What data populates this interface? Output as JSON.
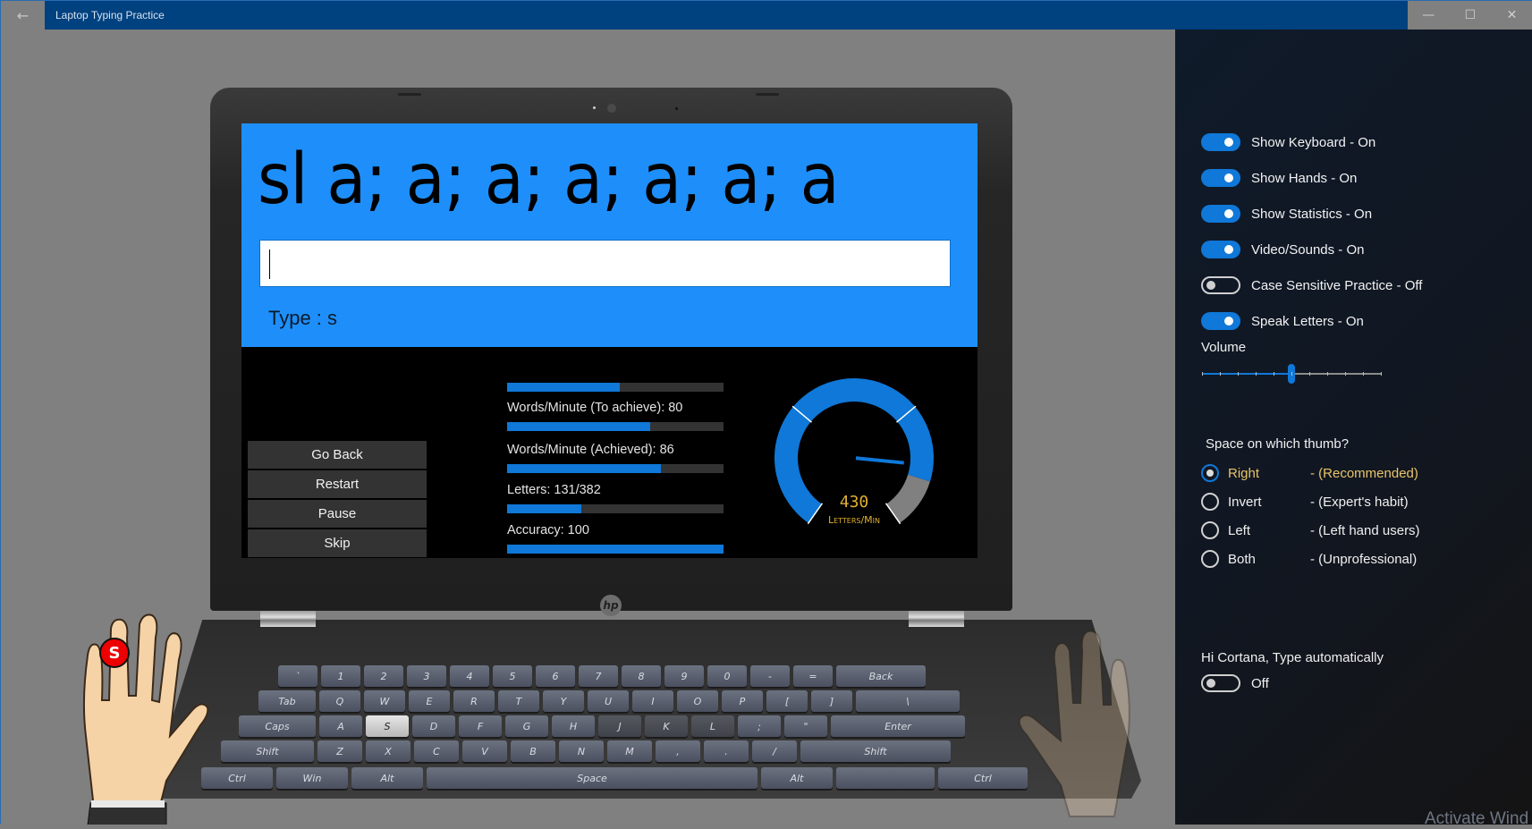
{
  "window": {
    "title": "Laptop Typing Practice",
    "back_icon": "←",
    "minimize_icon": "—",
    "maximize_icon": "☐",
    "close_icon": "✕"
  },
  "practice": {
    "text": "sl a; a; a; a; a; a; a",
    "input_value": "",
    "hint": "Type : s",
    "next_key": "s",
    "finger_badge": "S"
  },
  "controls": {
    "go_back": "Go Back",
    "restart": "Restart",
    "pause": "Pause",
    "skip": "Skip"
  },
  "stats": [
    {
      "label": "",
      "progress": 0.52
    },
    {
      "label": "Words/Minute (To achieve): 80",
      "progress": 0.66
    },
    {
      "label": "Words/Minute (Achieved): 86",
      "progress": 0.71
    },
    {
      "label": "Letters: 131/382",
      "progress": 0.343
    },
    {
      "label": "Accuracy: 100",
      "progress": 1.0
    }
  ],
  "gauge": {
    "value": "430",
    "unit": "Letters/Min",
    "needle_fraction": 0.83,
    "arc_color": "#0f78d8",
    "over_color": "#808080",
    "text_color": "#e0b030"
  },
  "brand": "hp",
  "keyboard": {
    "rows": [
      [
        "`",
        "1",
        "2",
        "3",
        "4",
        "5",
        "6",
        "7",
        "8",
        "9",
        "0",
        "-",
        "=",
        "Back"
      ],
      [
        "Tab",
        "Q",
        "W",
        "E",
        "R",
        "T",
        "Y",
        "U",
        "I",
        "O",
        "P",
        "[",
        "]",
        "\\"
      ],
      [
        "Caps",
        "A",
        "S",
        "D",
        "F",
        "G",
        "H",
        "J",
        "K",
        "L",
        ";",
        "\"",
        "Enter"
      ],
      [
        "Shift",
        "Z",
        "X",
        "C",
        "V",
        "B",
        "N",
        "M",
        ",",
        ".",
        "/",
        "Shift"
      ],
      [
        "Ctrl",
        "Win",
        "Alt",
        "Space",
        "Alt",
        "",
        "Ctrl"
      ]
    ],
    "active_key": "S",
    "home_keys": [
      "J",
      "K",
      "L"
    ]
  },
  "settings": {
    "toggles": [
      {
        "label": "Show Keyboard - On",
        "on": true
      },
      {
        "label": "Show Hands - On",
        "on": true
      },
      {
        "label": "Show Statistics - On",
        "on": true
      },
      {
        "label": "Video/Sounds - On",
        "on": true
      },
      {
        "label": "Case Sensitive Practice - Off",
        "on": false
      },
      {
        "label": "Speak Letters - On",
        "on": true
      }
    ],
    "volume_label": "Volume",
    "volume": 0.5,
    "thumb_question": "Space on which thumb?",
    "thumb_options": [
      {
        "name": "Right",
        "note": "- (Recommended)",
        "selected": true
      },
      {
        "name": "Invert",
        "note": "- (Expert's habit)",
        "selected": false
      },
      {
        "name": "Left",
        "note": "- (Left hand users)",
        "selected": false
      },
      {
        "name": "Both",
        "note": "- (Unprofessional)",
        "selected": false
      }
    ],
    "cortana_label": "Hi Cortana, Type automatically",
    "cortana_state": "Off",
    "cortana_on": false
  },
  "watermark": "Activate Wind"
}
